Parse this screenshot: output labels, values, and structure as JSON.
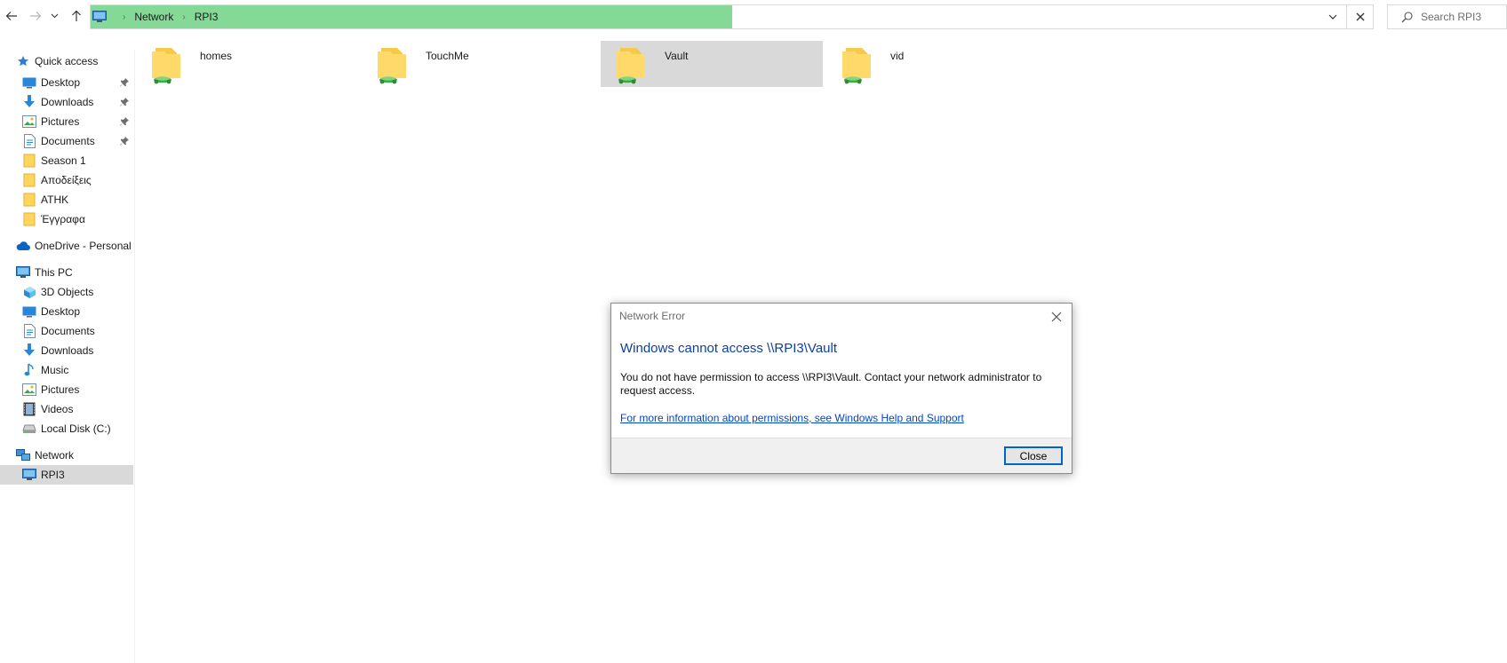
{
  "toolbar": {
    "back_icon": "arrow-left-icon",
    "forward_icon": "arrow-right-icon",
    "recent_icon": "chevron-down-icon",
    "up_icon": "arrow-up-icon"
  },
  "address_bar": {
    "progress_fraction": 0.5,
    "progress_color": "#85d996",
    "location_icon": "computer-icon",
    "breadcrumbs": [
      "Network",
      "RPI3"
    ]
  },
  "search": {
    "placeholder": "Search RPI3"
  },
  "sidebar": {
    "quick_access": {
      "label": "Quick access",
      "items": [
        {
          "label": "Desktop",
          "icon": "desktop-icon",
          "pinned": true
        },
        {
          "label": "Downloads",
          "icon": "download-icon",
          "pinned": true
        },
        {
          "label": "Pictures",
          "icon": "pictures-icon",
          "pinned": true
        },
        {
          "label": "Documents",
          "icon": "documents-icon",
          "pinned": true
        },
        {
          "label": "Season 1",
          "icon": "folder-icon",
          "pinned": false
        },
        {
          "label": "Αποδείξεις",
          "icon": "folder-icon",
          "pinned": false
        },
        {
          "label": "ATHK",
          "icon": "folder-icon",
          "pinned": false
        },
        {
          "label": "Έγγραφα",
          "icon": "folder-icon",
          "pinned": false
        }
      ]
    },
    "onedrive": {
      "label": "OneDrive - Personal"
    },
    "this_pc": {
      "label": "This PC",
      "items": [
        {
          "label": "3D Objects",
          "icon": "cube-icon"
        },
        {
          "label": "Desktop",
          "icon": "desktop-icon"
        },
        {
          "label": "Documents",
          "icon": "documents-icon"
        },
        {
          "label": "Downloads",
          "icon": "download-icon"
        },
        {
          "label": "Music",
          "icon": "music-icon"
        },
        {
          "label": "Pictures",
          "icon": "pictures-icon"
        },
        {
          "label": "Videos",
          "icon": "videos-icon"
        },
        {
          "label": "Local Disk (C:)",
          "icon": "disk-icon"
        }
      ]
    },
    "network": {
      "label": "Network",
      "items": [
        {
          "label": "RPI3",
          "icon": "computer-icon",
          "selected": true
        }
      ]
    }
  },
  "content": {
    "folders": [
      {
        "name": "homes",
        "selected": false
      },
      {
        "name": "TouchMe",
        "selected": false
      },
      {
        "name": "Vault",
        "selected": true
      },
      {
        "name": "vid",
        "selected": false
      }
    ]
  },
  "dialog": {
    "title": "Network Error",
    "heading": "Windows cannot access \\\\RPI3\\Vault",
    "body": "You do not have permission to access \\\\RPI3\\Vault. Contact your network administrator to request access.",
    "link": "For more information about permissions, see Windows Help and Support",
    "close_button": "Close"
  },
  "colors": {
    "accent": "#0067c0",
    "heading": "#0d3fa0",
    "link": "#0046c8",
    "selection": "#d9d9d9"
  }
}
